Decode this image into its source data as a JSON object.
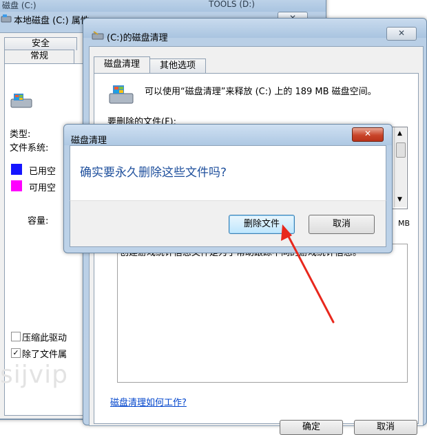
{
  "background_window": {
    "title_left": "磁盘 (C:)",
    "title_right": "TOOLS (D:)",
    "title": "本地磁盘 (C:) 属性",
    "close_glyph": "✕",
    "tabs": [
      "安全",
      "常规"
    ],
    "type_label": "类型:",
    "fs_label": "文件系统:",
    "used_label": "已用空",
    "free_label": "可用空",
    "capacity_label": "容量:",
    "compress_label": "压缩此驱动",
    "index_label": "除了文件属",
    "used_color": "#1515ff",
    "free_color": "#ff00ff",
    "watermark": "sijvip"
  },
  "cleanup_window": {
    "title": "(C:)的磁盘清理",
    "close_glyph": "✕",
    "tabs": [
      "磁盘清理",
      "其他选项"
    ],
    "description": "可以使用“磁盘清理”来释放  (C:) 上的 189 MB 磁盘空间。",
    "files_to_delete_label": "要删除的文件(F):",
    "side_text": "MB",
    "file_description": "创建游戏统计信息文件是为了帮助跟踪不同的游戏统计信息。",
    "how_link": "磁盘清理如何工作?",
    "ok_label": "确定",
    "cancel_label": "取消"
  },
  "confirm_dialog": {
    "title": "磁盘清理",
    "close_glyph": "✕",
    "question": "确实要永久删除这些文件吗?",
    "delete_button": "删除文件",
    "cancel_button": "取消",
    "question_color": "#1e4f9c"
  }
}
